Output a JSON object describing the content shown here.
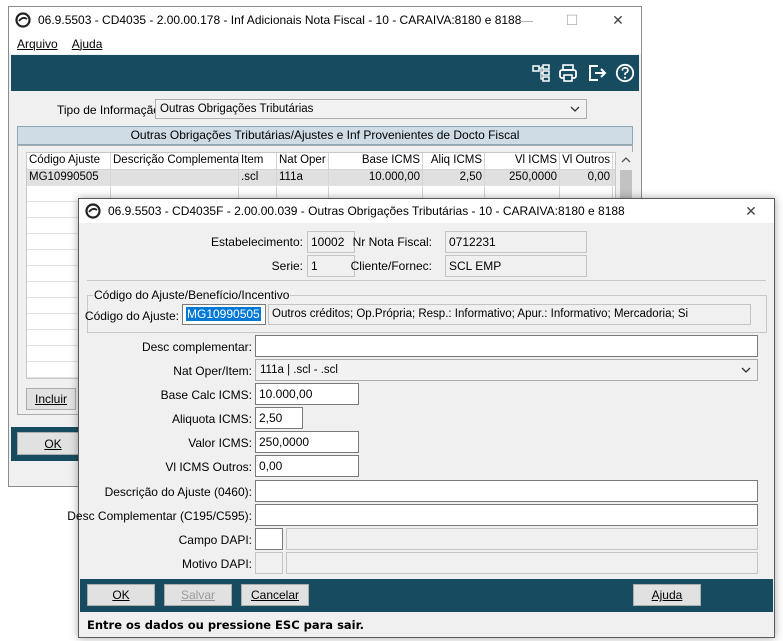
{
  "main_window": {
    "title": "06.9.5503 - CD4035 - 2.00.00.178 - Inf Adicionais Nota Fiscal - 10 - CARAIVA:8180 e 8188",
    "menu": [
      {
        "label": "Arquivo"
      },
      {
        "label": "Ajuda"
      }
    ],
    "toolbar_icons": [
      "structure-icon",
      "printer-icon",
      "exit-icon",
      "help-icon"
    ],
    "tipo_label": "Tipo de Informação:",
    "tipo_value": "Outras Obrigações Tributárias",
    "group_title": "Outras Obrigações Tributárias/Ajustes e Inf Provenientes de Docto Fiscal",
    "grid": {
      "columns": [
        "Código Ajuste",
        "Descrição Complementar",
        "Item",
        "Nat Oper",
        "Base ICMS",
        "Aliq ICMS",
        "Vl ICMS",
        "Vl Outros"
      ],
      "rows": [
        [
          "MG10990505",
          "",
          ".scl",
          "111a",
          "10.000,00",
          "2,50",
          "250,0000",
          "0,00"
        ]
      ]
    },
    "incluir_label": "Incluir",
    "ok_label": "OK"
  },
  "dialog": {
    "title": "06.9.5503 - CD4035F - 2.00.00.039 - Outras Obrigações Tributárias - 10 - CARAIVA:8180 e 8188",
    "estabelecimento_label": "Estabelecimento:",
    "estabelecimento_value": "10002",
    "nr_nota_label": "Nr Nota Fiscal:",
    "nr_nota_value": "0712231",
    "serie_label": "Serie:",
    "serie_value": "1",
    "cliente_label": "Cliente/Fornec:",
    "cliente_value": "SCL EMP",
    "group_title": "Código do Ajuste/Benefício/Incentivo",
    "codigo_label": "Código do Ajuste:",
    "codigo_value": "MG10990505",
    "codigo_desc": "Outros créditos; Op.Própria; Resp.: Informativo; Apur.: Informativo;  Mercadoria;  Si",
    "desc_comp_label": "Desc complementar:",
    "desc_comp_value": "",
    "nat_oper_label": "Nat Oper/Item:",
    "nat_oper_value": "111a | .scl - .scl",
    "base_calc_label": "Base Calc ICMS:",
    "base_calc_value": "10.000,00",
    "aliquota_label": "Aliquota ICMS:",
    "aliquota_value": "2,50",
    "valor_label": "Valor ICMS:",
    "valor_value": "250,0000",
    "vl_outros_label": "Vl ICMS Outros:",
    "vl_outros_value": "0,00",
    "desc_ajuste_label": "Descrição do Ajuste (0460):",
    "desc_ajuste_value": "",
    "desc_c195_label": "Desc Complementar (C195/C595):",
    "desc_c195_value": "",
    "campo_dapi_label": "Campo DAPI:",
    "motivo_dapi_label": "Motivo DAPI:",
    "buttons": {
      "ok": "OK",
      "salvar": "Salvar",
      "cancelar": "Cancelar",
      "ajuda": "Ajuda"
    },
    "status": "Entre os dados ou pressione ESC para sair."
  }
}
